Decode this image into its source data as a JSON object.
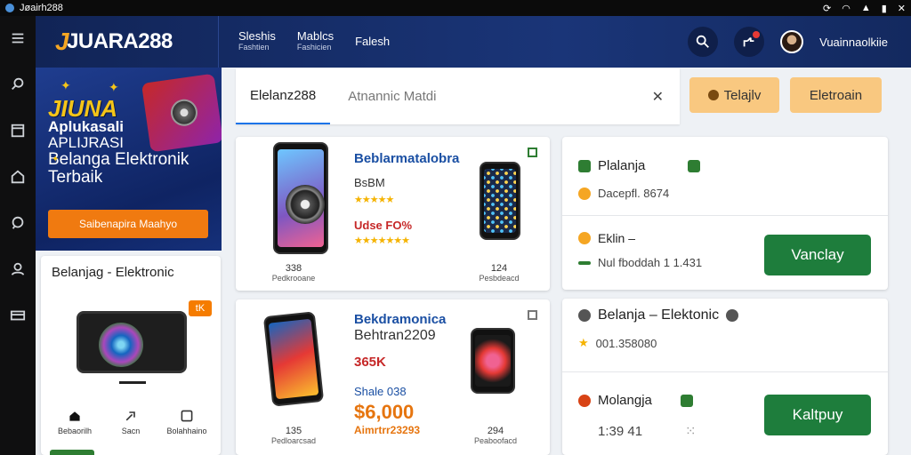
{
  "statusbar": {
    "app_name": "Jøairh288",
    "icons": [
      "sync-icon",
      "wifi-icon",
      "signal-icon",
      "battery-icon",
      "close-icon"
    ]
  },
  "rail": {
    "icons": [
      "menu-icon",
      "search-icon",
      "window-icon",
      "home-icon",
      "chat-icon",
      "profile-icon",
      "card-icon"
    ]
  },
  "header": {
    "logo": "JUARA288",
    "logo_mark": "J",
    "nav": [
      {
        "label": "Sleshis",
        "sub": "Fashtien"
      },
      {
        "label": "Mablcs",
        "sub": "Fashicien"
      },
      {
        "label": "Falesh",
        "sub": ""
      }
    ],
    "username": "Vuainnaolkiie"
  },
  "promo": {
    "line1": "JIUNA",
    "line2": "Aplukasali",
    "line3": "APLIJRASI",
    "line4": "Belanga Elektronik",
    "line5": "Terbaik",
    "cta": "Saibenapira Maahyo"
  },
  "left_card": {
    "title": "Belanjag - Elektronic",
    "badge": "tK",
    "bottom_nav": [
      {
        "label": "Bebaorilh",
        "icon": "home-icon"
      },
      {
        "label": "Sacn",
        "icon": "share-icon"
      },
      {
        "label": "Bolahhaino",
        "icon": "box-icon"
      }
    ]
  },
  "search": {
    "tab_label": "Elelanz288",
    "placeholder": "Atnannic Matdi",
    "clear_label": "✕"
  },
  "chips": [
    {
      "label": "Telajlv"
    },
    {
      "label": "Eletroain"
    }
  ],
  "products": [
    {
      "title": "Beblarmatalobra",
      "subtitle": "BsBM",
      "price_line": "Udse FO%",
      "left_caption": "338",
      "left_caption_sub": "Pedkrooane",
      "right_caption": "124",
      "right_caption_sub": "Pesbdeacd"
    },
    {
      "title": "Bekdramonica",
      "subtitle": "Behtran2209",
      "price_small": "365K",
      "price_label": "Shale 038",
      "price_big": "$6,000",
      "price_sub": "Aimrtrr23293",
      "left_caption": "135",
      "left_caption_sub": "Pedloarcsad",
      "right_caption": "294",
      "right_caption_sub": "Peaboofacd"
    }
  ],
  "info_cards": [
    {
      "rows": [
        {
          "icon": "shop-icon",
          "text": "Plalanja",
          "color": "#2e7d32"
        },
        {
          "icon": "like-icon",
          "text": "Dacepfl. 8674",
          "color": "#f5a623"
        },
        {
          "icon": "like-icon",
          "text": "Eklin –",
          "color": "#f5a623"
        },
        {
          "icon": "link-icon",
          "text": "Nul fboddah 1 1.431",
          "color": "#2e7d32"
        }
      ],
      "button": "Vanclay"
    },
    {
      "rows": [
        {
          "icon": "clock-icon",
          "text": "Belanja – Elektonic",
          "color": "#555"
        },
        {
          "icon": "star-icon",
          "text": "001.358080",
          "color": "#f5b301"
        },
        {
          "icon": "pin-icon",
          "text": "Molangja",
          "color": "#d84315"
        },
        {
          "icon": "",
          "text": "1:39 41",
          "color": "#444"
        }
      ],
      "button": "Kaltpuy"
    }
  ],
  "colors": {
    "header": "#1a3578",
    "accent_orange": "#f07a10",
    "chip": "#f9c880",
    "green_button": "#1e7d3c"
  }
}
